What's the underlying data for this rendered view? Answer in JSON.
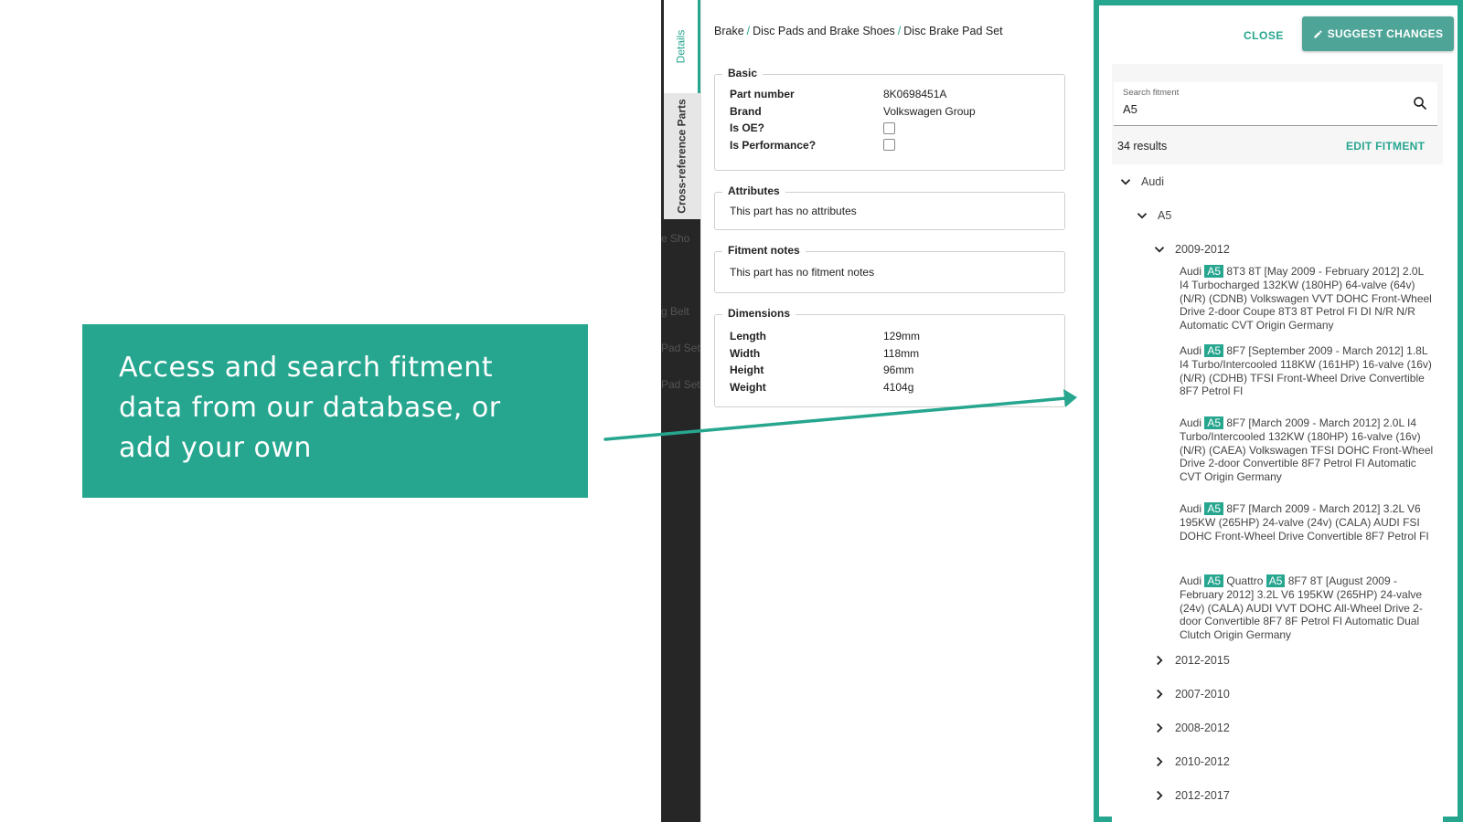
{
  "callout": {
    "text": "Access and search fitment data from our database, or add your own"
  },
  "background_app": {
    "ghost_items": [
      "g Belt",
      "Pad Set",
      "Pad Set",
      "e Sho"
    ]
  },
  "tabs": {
    "details": "Details",
    "cross_reference": "Cross-reference Parts"
  },
  "breadcrumb": {
    "items": [
      "Brake",
      "Disc Pads and Brake Shoes",
      "Disc Brake Pad Set"
    ],
    "separator": "/"
  },
  "basic": {
    "legend": "Basic",
    "part_number_label": "Part number",
    "part_number_value": "8K0698451A",
    "brand_label": "Brand",
    "brand_value": "Volkswagen Group",
    "is_oe_label": "Is OE?",
    "is_performance_label": "Is Performance?"
  },
  "attributes": {
    "legend": "Attributes",
    "note": "This part has no attributes"
  },
  "fitment_notes": {
    "legend": "Fitment notes",
    "note": "This part has no fitment notes"
  },
  "dimensions": {
    "legend": "Dimensions",
    "length_label": "Length",
    "length_value": "129mm",
    "width_label": "Width",
    "width_value": "118mm",
    "height_label": "Height",
    "height_value": "96mm",
    "weight_label": "Weight",
    "weight_value": "4104g"
  },
  "fitment": {
    "close_label": "CLOSE",
    "suggest_label": "SUGGEST CHANGES",
    "search_label": "Search fitment",
    "search_value": "A5",
    "results_count": "34 results",
    "edit_label": "EDIT FITMENT",
    "make": "Audi",
    "model": "A5",
    "year_open": "2009-2012",
    "vehicles": [
      {
        "pre": "Audi ",
        "hl": "A5",
        "mid": "",
        "hl2": "",
        "post": " 8T3 8T [May 2009 - February 2012] 2.0L I4 Turbocharged 132KW (180HP) 64-valve (64v) (N/R) (CDNB) Volkswagen VVT DOHC Front-Wheel Drive 2-door Coupe 8T3 8T Petrol FI DI N/R N/R Automatic CVT Origin Germany"
      },
      {
        "pre": "Audi ",
        "hl": "A5",
        "mid": "",
        "hl2": "",
        "post": " 8F7 [September 2009 - March 2012] 1.8L I4 Turbo/Intercooled 118KW (161HP) 16-valve (16v) (N/R) (CDHB) TFSI Front-Wheel Drive Convertible 8F7 Petrol FI"
      },
      {
        "pre": "Audi ",
        "hl": "A5",
        "mid": "",
        "hl2": "",
        "post": " 8F7 [March 2009 - March 2012] 2.0L I4 Turbo/Intercooled 132KW (180HP) 16-valve (16v) (N/R) (CAEA) Volkswagen TFSI DOHC Front-Wheel Drive 2-door Convertible 8F7 Petrol FI Automatic CVT Origin Germany"
      },
      {
        "pre": "Audi ",
        "hl": "A5",
        "mid": "",
        "hl2": "",
        "post": " 8F7 [March 2009 - March 2012] 3.2L V6 195KW (265HP) 24-valve (24v) (CALA) AUDI FSI DOHC Front-Wheel Drive Convertible 8F7 Petrol FI"
      },
      {
        "pre": "Audi ",
        "hl": "A5",
        "mid": " Quattro ",
        "hl2": "A5",
        "post": " 8F7 8T [August 2009 - February 2012] 3.2L V6 195KW (265HP) 24-valve (24v) (CALA) AUDI VVT DOHC All-Wheel Drive 2-door Convertible 8F7 8F Petrol FI Automatic Dual Clutch Origin Germany"
      }
    ],
    "other_years": [
      "2012-2015",
      "2007-2010",
      "2008-2012",
      "2010-2012",
      "2012-2017"
    ]
  }
}
